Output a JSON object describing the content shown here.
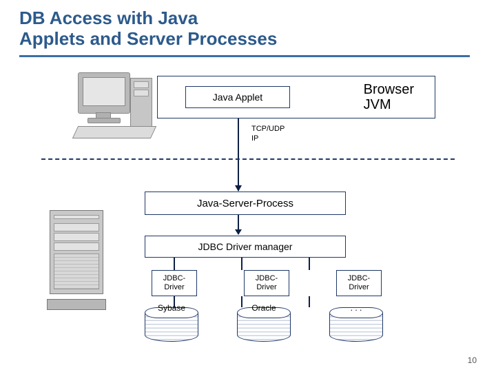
{
  "title_line1": "DB Access with Java",
  "title_line2": "Applets and Server Processes",
  "browser_jvm": "Browser\nJVM",
  "java_applet": "Java Applet",
  "protocol_line1": "TCP/UDP",
  "protocol_line2": "IP",
  "java_server_process": "Java-Server-Process",
  "jdbc_manager": "JDBC Driver manager",
  "driver_label": "JDBC-\nDriver",
  "db1": "Sybase",
  "db2": "Oracle",
  "db3": ". . .",
  "page_number": "10",
  "colors": {
    "accent": "#2c5a8c",
    "border": "#1e3766"
  }
}
